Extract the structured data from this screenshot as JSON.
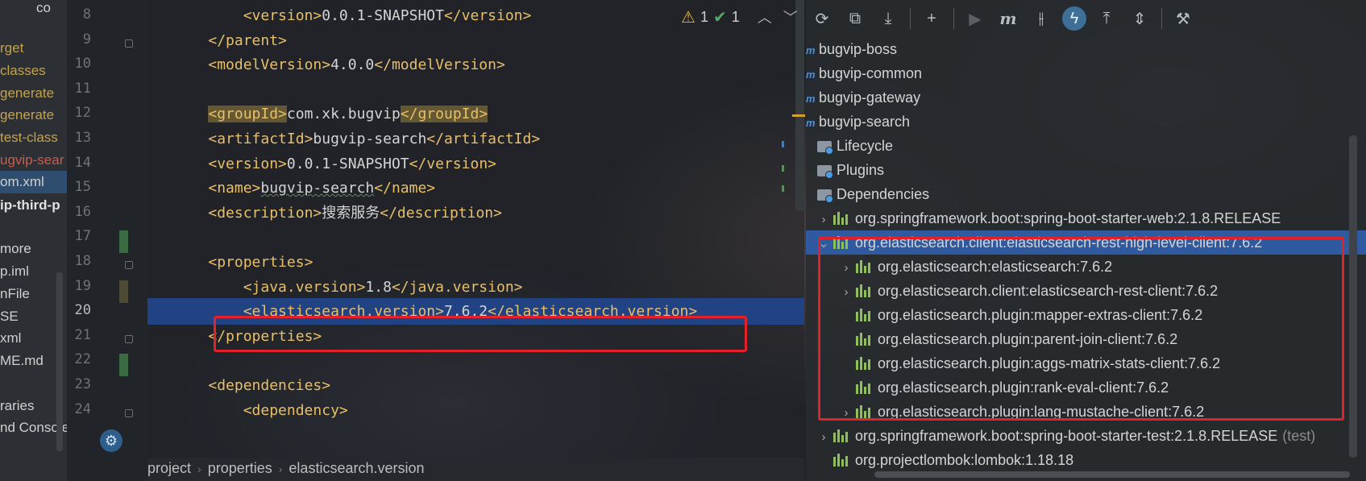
{
  "project_tree": {
    "items": [
      {
        "text": "co",
        "style": "white"
      },
      {
        "text": "rget",
        "style": "orange"
      },
      {
        "text": "classes",
        "style": "orange"
      },
      {
        "text": "generate",
        "style": "orange"
      },
      {
        "text": "generate",
        "style": "orange"
      },
      {
        "text": "test-class",
        "style": "orange"
      },
      {
        "text": "ugvip-sear",
        "style": "red"
      },
      {
        "text": "om.xml",
        "style": "white"
      },
      {
        "text": "ip-third-p",
        "style": "bold"
      },
      {
        "text": "more",
        "style": "white"
      },
      {
        "text": "p.iml",
        "style": "white"
      },
      {
        "text": "nFile",
        "style": "white"
      },
      {
        "text": "SE",
        "style": "white"
      },
      {
        "text": "xml",
        "style": "white"
      },
      {
        "text": "ME.md",
        "style": "white"
      },
      {
        "text": "raries",
        "style": "white"
      },
      {
        "text": "nd Console",
        "style": "white"
      }
    ]
  },
  "editor": {
    "line_numbers": [
      "8",
      "9",
      "10",
      "11",
      "12",
      "13",
      "14",
      "15",
      "16",
      "17",
      "18",
      "19",
      "20",
      "21",
      "22",
      "23",
      "24"
    ],
    "current_line": "20",
    "lines": [
      {
        "indent": "        ",
        "open": "<version>",
        "text": "0.0.1-SNAPSHOT",
        "close": "</version>"
      },
      {
        "indent": "    ",
        "open": "</parent>",
        "text": "",
        "close": ""
      },
      {
        "indent": "    ",
        "open": "<modelVersion>",
        "text": "4.0.0",
        "close": "</modelVersion>"
      },
      {
        "indent": "",
        "open": "",
        "text": "",
        "close": ""
      },
      {
        "indent": "    ",
        "open": "<groupId>",
        "text": "com.xk.bugvip",
        "close": "</groupId>",
        "highlight": true
      },
      {
        "indent": "    ",
        "open": "<artifactId>",
        "text": "bugvip-search",
        "close": "</artifactId>"
      },
      {
        "indent": "    ",
        "open": "<version>",
        "text": "0.0.1-SNAPSHOT",
        "close": "</version>"
      },
      {
        "indent": "    ",
        "open": "<name>",
        "text": "bugvip-search",
        "close": "</name>",
        "squiggle": true
      },
      {
        "indent": "    ",
        "open": "<description>",
        "text": "搜索服务",
        "close": "</description>"
      },
      {
        "indent": "",
        "open": "",
        "text": "",
        "close": ""
      },
      {
        "indent": "    ",
        "open": "<properties>",
        "text": "",
        "close": ""
      },
      {
        "indent": "        ",
        "open": "<java.version>",
        "text": "1.8",
        "close": "</java.version>"
      },
      {
        "indent": "        ",
        "open": "<elasticsearch.version>",
        "text": "7.6.2",
        "close": "</elasticsearch.version>"
      },
      {
        "indent": "    ",
        "open": "</properties>",
        "text": "",
        "close": ""
      },
      {
        "indent": "",
        "open": "",
        "text": "",
        "close": ""
      },
      {
        "indent": "    ",
        "open": "<dependencies>",
        "text": "",
        "close": ""
      },
      {
        "indent": "        ",
        "open": "<dependency>",
        "text": "",
        "close": ""
      }
    ],
    "inspections": {
      "warnings": "1",
      "weak_warnings": "1"
    },
    "breadcrumb": [
      "project",
      "properties",
      "elasticsearch.version"
    ]
  },
  "maven": {
    "toolbar": [
      {
        "name": "reload-icon",
        "glyph": "⟳"
      },
      {
        "name": "generate-sources-icon",
        "glyph": "⧉"
      },
      {
        "name": "download-icon",
        "glyph": "⤓"
      },
      {
        "name": "add-icon",
        "glyph": "+"
      },
      {
        "name": "run-icon",
        "glyph": "▶"
      },
      {
        "name": "maven-goal-icon",
        "glyph": "m"
      },
      {
        "name": "skip-tests-icon",
        "glyph": "⫲"
      },
      {
        "name": "offline-mode-icon",
        "glyph": "ϟ"
      },
      {
        "name": "show-dependencies-icon",
        "glyph": "⤒"
      },
      {
        "name": "collapse-all-icon",
        "glyph": "⇕"
      },
      {
        "name": "settings-wrench-icon",
        "glyph": "⚒"
      }
    ],
    "modules": [
      "bugvip-boss",
      "bugvip-common",
      "bugvip-gateway",
      "bugvip-search"
    ],
    "sections": [
      "Lifecycle",
      "Plugins",
      "Dependencies"
    ],
    "dependencies": [
      {
        "label": "org.springframework.boot:spring-boot-starter-web:2.1.8.RELEASE",
        "level": 0,
        "chevron": "›",
        "scope": ""
      },
      {
        "label": "org.elasticsearch.client:elasticsearch-rest-high-level-client:7.6.2",
        "level": 0,
        "chevron": "⌄",
        "scope": "",
        "selected": true
      },
      {
        "label": "org.elasticsearch:elasticsearch:7.6.2",
        "level": 1,
        "chevron": "›",
        "scope": ""
      },
      {
        "label": "org.elasticsearch.client:elasticsearch-rest-client:7.6.2",
        "level": 1,
        "chevron": "›",
        "scope": ""
      },
      {
        "label": "org.elasticsearch.plugin:mapper-extras-client:7.6.2",
        "level": 1,
        "chevron": "",
        "scope": ""
      },
      {
        "label": "org.elasticsearch.plugin:parent-join-client:7.6.2",
        "level": 1,
        "chevron": "",
        "scope": ""
      },
      {
        "label": "org.elasticsearch.plugin:aggs-matrix-stats-client:7.6.2",
        "level": 1,
        "chevron": "",
        "scope": ""
      },
      {
        "label": "org.elasticsearch.plugin:rank-eval-client:7.6.2",
        "level": 1,
        "chevron": "",
        "scope": ""
      },
      {
        "label": "org.elasticsearch.plugin:lang-mustache-client:7.6.2",
        "level": 1,
        "chevron": "›",
        "scope": ""
      },
      {
        "label": "org.springframework.boot:spring-boot-starter-test:2.1.8.RELEASE",
        "level": 0,
        "chevron": "›",
        "scope": "(test)"
      },
      {
        "label": "org.projectlombok:lombok:1.18.18",
        "level": 0,
        "chevron": "",
        "scope": ""
      }
    ]
  },
  "colors": {
    "highlight_box": "#e2212b",
    "selection": "#2f5aa0",
    "xml_tag": "#e8bf6a"
  }
}
